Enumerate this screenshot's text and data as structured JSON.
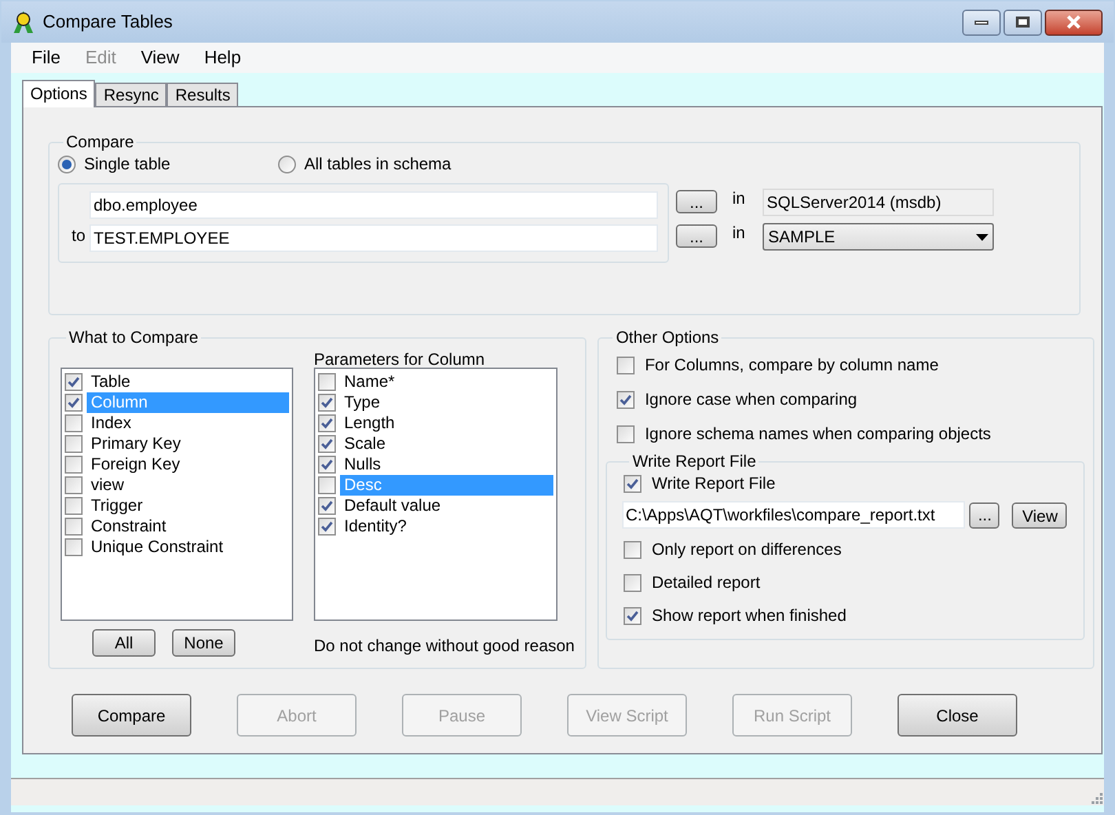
{
  "window": {
    "title": "Compare Tables"
  },
  "menu": [
    {
      "label": "File",
      "disabled": false
    },
    {
      "label": "Edit",
      "disabled": true
    },
    {
      "label": "View",
      "disabled": false
    },
    {
      "label": "Help",
      "disabled": false
    }
  ],
  "tabs": [
    {
      "label": "Options",
      "selected": true
    },
    {
      "label": "Resync",
      "selected": false
    },
    {
      "label": "Results",
      "selected": false
    }
  ],
  "compare": {
    "title": "Compare",
    "modes": [
      {
        "label": "Single table",
        "selected": true
      },
      {
        "label": "All tables in schema",
        "selected": false
      }
    ],
    "source": {
      "value": "dbo.employee",
      "browse": "...",
      "in_label": "in",
      "database": "SQLServer2014 (msdb)"
    },
    "target": {
      "prefix": "to",
      "value": "TEST.EMPLOYEE",
      "browse": "...",
      "in_label": "in",
      "database": "SAMPLE"
    }
  },
  "what_to_compare": {
    "title": "What to Compare",
    "objects": [
      {
        "label": "Table",
        "checked": true,
        "selected": false
      },
      {
        "label": "Column",
        "checked": true,
        "selected": true
      },
      {
        "label": "Index",
        "checked": false,
        "selected": false
      },
      {
        "label": "Primary Key",
        "checked": false,
        "selected": false
      },
      {
        "label": "Foreign Key",
        "checked": false,
        "selected": false
      },
      {
        "label": "view",
        "checked": false,
        "selected": false
      },
      {
        "label": "Trigger",
        "checked": false,
        "selected": false
      },
      {
        "label": "Constraint",
        "checked": false,
        "selected": false
      },
      {
        "label": "Unique Constraint",
        "checked": false,
        "selected": false
      }
    ],
    "buttons": [
      "All",
      "None"
    ],
    "parameters_title": "Parameters for Column",
    "parameters": [
      {
        "label": "Name*",
        "checked": false,
        "selected": false
      },
      {
        "label": "Type",
        "checked": true,
        "selected": false
      },
      {
        "label": "Length",
        "checked": true,
        "selected": false
      },
      {
        "label": "Scale",
        "checked": true,
        "selected": false
      },
      {
        "label": "Nulls",
        "checked": true,
        "selected": false
      },
      {
        "label": "Desc",
        "checked": false,
        "selected": true
      },
      {
        "label": "Default value",
        "checked": true,
        "selected": false
      },
      {
        "label": "Identity?",
        "checked": true,
        "selected": false
      }
    ],
    "note": "Do not change without good reason"
  },
  "other_options": {
    "title": "Other Options",
    "options": [
      {
        "label": "For Columns, compare by column name",
        "checked": false
      },
      {
        "label": "Ignore case when comparing",
        "checked": true
      },
      {
        "label": "Ignore schema names when comparing objects",
        "checked": false
      }
    ],
    "report": {
      "title": "Write Report File",
      "write": {
        "label": "Write Report File",
        "checked": true
      },
      "path": "C:\\Apps\\AQT\\workfiles\\compare_report.txt",
      "browse": "...",
      "view": "View",
      "options": [
        {
          "label": "Only report on differences",
          "checked": false
        },
        {
          "label": "Detailed report",
          "checked": false
        },
        {
          "label": "Show report when finished",
          "checked": true
        }
      ]
    }
  },
  "actions": [
    {
      "label": "Compare",
      "disabled": false
    },
    {
      "label": "Abort",
      "disabled": true
    },
    {
      "label": "Pause",
      "disabled": true
    },
    {
      "label": "View Script",
      "disabled": true
    },
    {
      "label": "Run Script",
      "disabled": true
    },
    {
      "label": "Close",
      "disabled": false
    }
  ]
}
